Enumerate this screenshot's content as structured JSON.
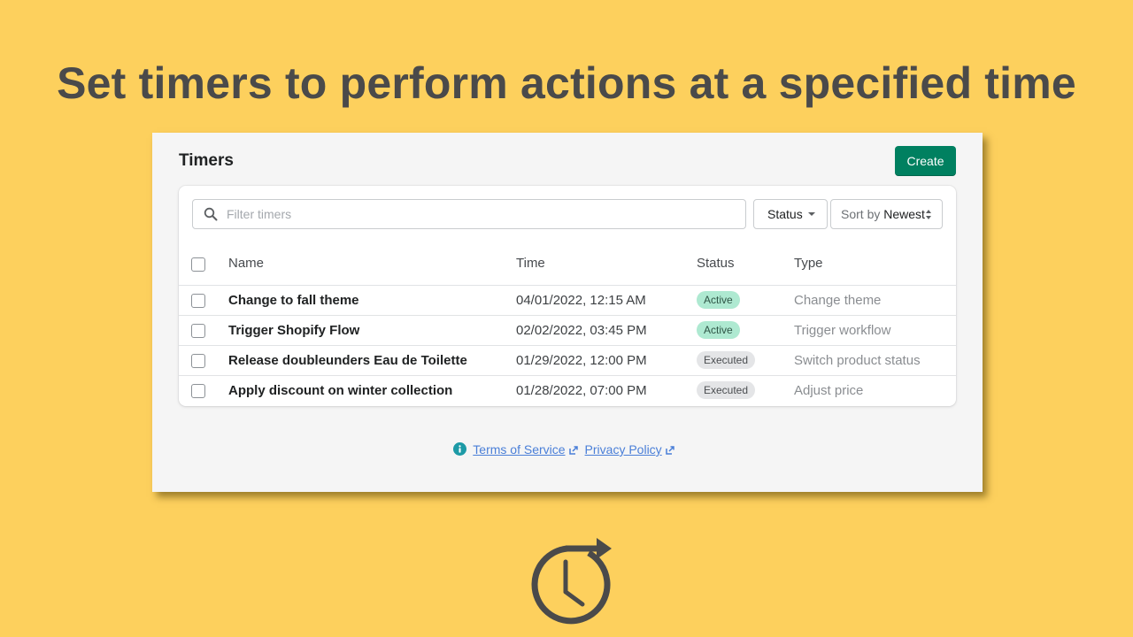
{
  "headline": "Set timers to perform actions at a specified time",
  "panel": {
    "title": "Timers",
    "create_label": "Create",
    "filter": {
      "placeholder": "Filter timers",
      "value": ""
    },
    "status_filter_label": "Status",
    "sort": {
      "label": "Sort by",
      "value": "Newest"
    },
    "table": {
      "columns": [
        "Name",
        "Time",
        "Status",
        "Type"
      ],
      "rows": [
        {
          "name": "Change to fall theme",
          "time": "04/01/2022, 12:15 AM",
          "status": "Active",
          "type": "Change theme"
        },
        {
          "name": "Trigger Shopify Flow",
          "time": "02/02/2022, 03:45 PM",
          "status": "Active",
          "type": "Trigger workflow"
        },
        {
          "name": "Release doubleunders Eau de Toilette",
          "time": "01/29/2022, 12:00 PM",
          "status": "Executed",
          "type": "Switch product status"
        },
        {
          "name": "Apply discount on winter collection",
          "time": "01/28/2022, 07:00 PM",
          "status": "Executed",
          "type": "Adjust price"
        }
      ]
    },
    "footer": {
      "terms_label": "Terms of Service",
      "privacy_label": "Privacy Policy"
    }
  },
  "colors": {
    "background": "#fdd05d",
    "primary_button": "#008060",
    "badge_active": "#aee9d1",
    "badge_executed": "#e4e5e7",
    "link": "#4a7fd8",
    "info_icon": "#1d9aa6",
    "headline_text": "#4a4a4a"
  },
  "icons": {
    "search": "search-icon",
    "status_caret": "caret-down-icon",
    "sort": "sort-updown-icon",
    "info": "info-icon",
    "external": "external-link-icon",
    "timer": "timer-clock-arrow-icon"
  }
}
